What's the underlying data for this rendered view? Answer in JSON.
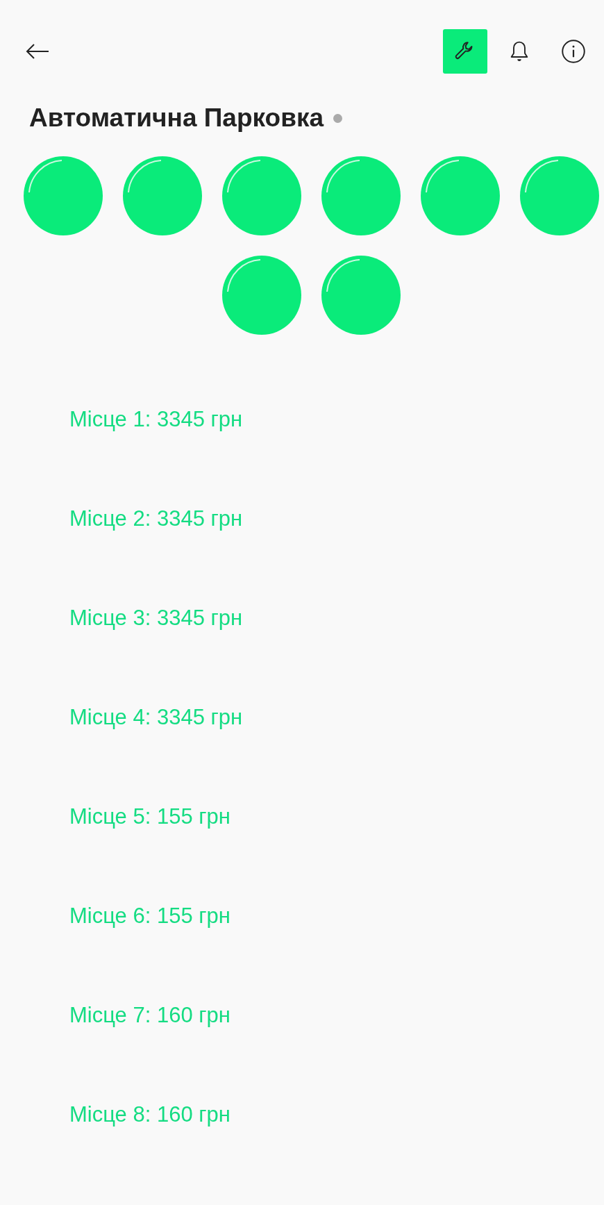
{
  "toolbar": [
    {
      "kind": "wrench",
      "selected": true
    },
    {
      "kind": "bell",
      "selected": false
    },
    {
      "kind": "info",
      "selected": false
    }
  ],
  "title": "Автоматична Парковка",
  "spots": [
    {
      "label": "Місце 1: 3345 грн"
    },
    {
      "label": "Місце 2: 3345 грн"
    },
    {
      "label": "Місце 3: 3345 грн"
    },
    {
      "label": "Місце 4: 3345 грн"
    },
    {
      "label": "Місце 5: 155 грн"
    },
    {
      "label": "Місце 6: 155 грн"
    },
    {
      "label": "Місце 7: 160 грн"
    },
    {
      "label": "Місце 8: 160 грн"
    }
  ]
}
